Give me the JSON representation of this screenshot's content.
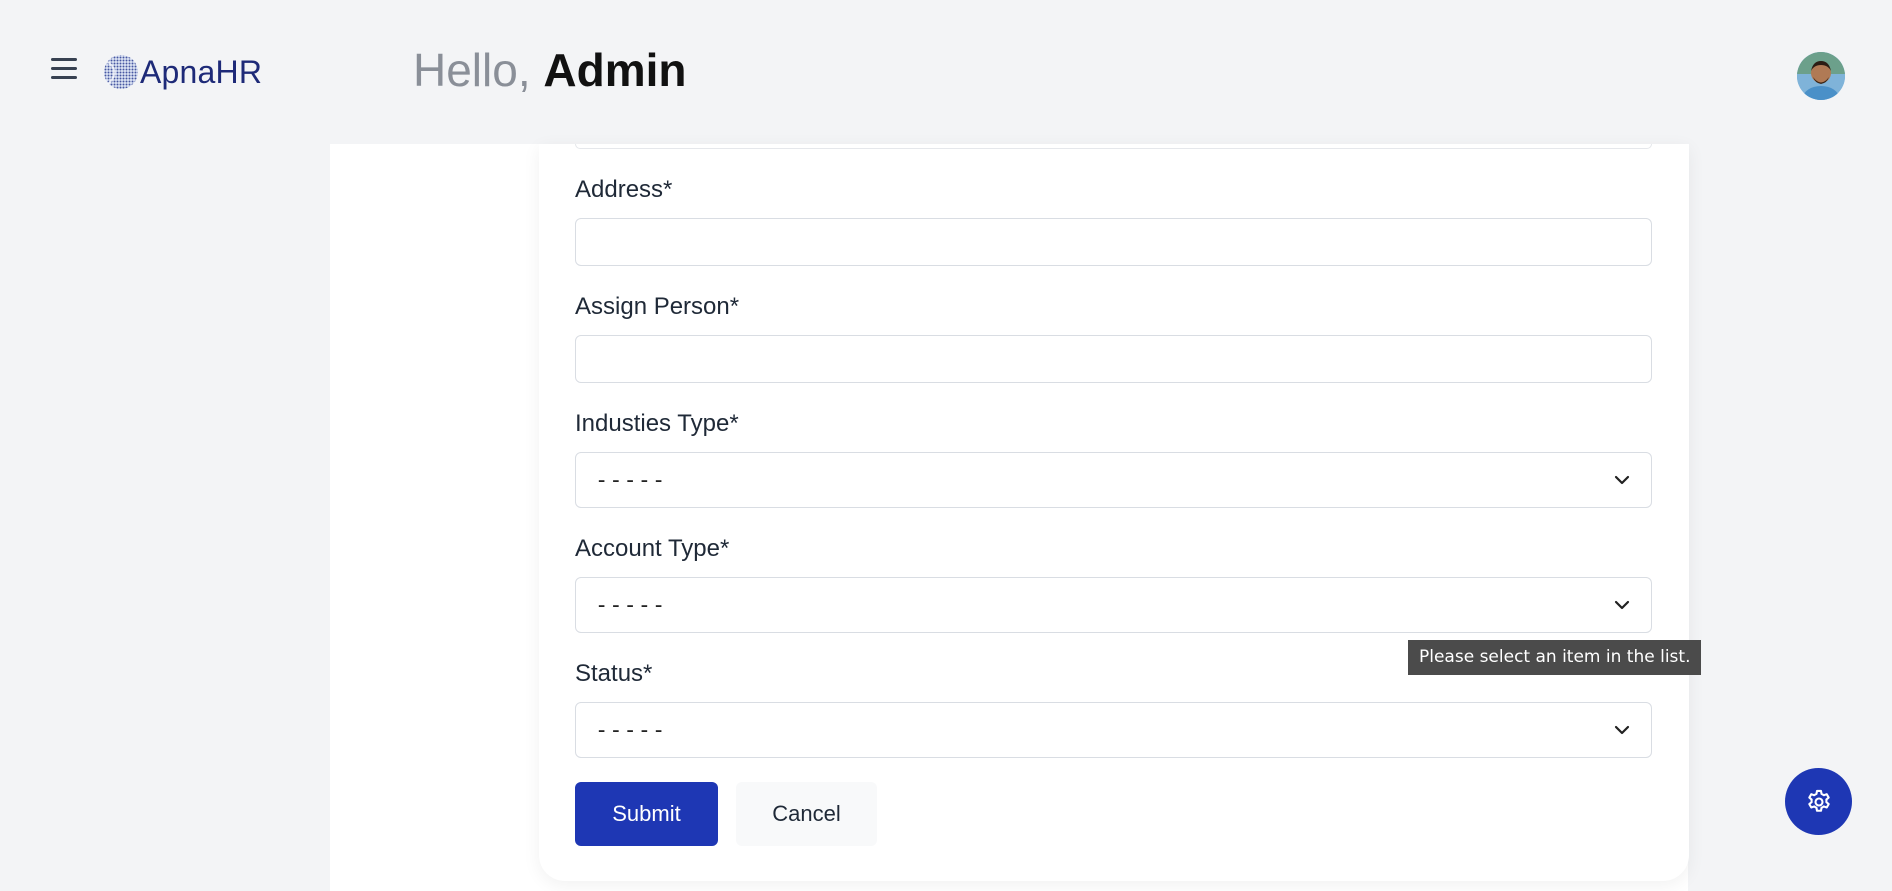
{
  "header": {
    "brand": "ApnaHR",
    "greeting_prefix": "Hello, ",
    "greeting_name": "Admin"
  },
  "form": {
    "address_label": "Address*",
    "address_value": "",
    "assign_person_label": "Assign Person*",
    "assign_person_value": "",
    "industries_type_label": "Industies Type*",
    "industries_type_selected": "-----",
    "account_type_label": "Account Type*",
    "account_type_selected": "-----",
    "status_label": "Status*",
    "status_selected": "-----",
    "validation_tooltip": "Please select an item in the list.",
    "submit_label": "Submit",
    "cancel_label": "Cancel"
  },
  "icons": {
    "menu": "hamburger-menu-icon",
    "logo": "apnahr-globe-logo",
    "avatar": "user-avatar",
    "chevron": "chevron-down-icon",
    "settings": "gear-icon"
  },
  "colors": {
    "primary": "#1e37b4",
    "brand_text": "#1e2a78",
    "page_bg": "#f3f4f6",
    "tooltip_bg": "#4b4b4b"
  }
}
